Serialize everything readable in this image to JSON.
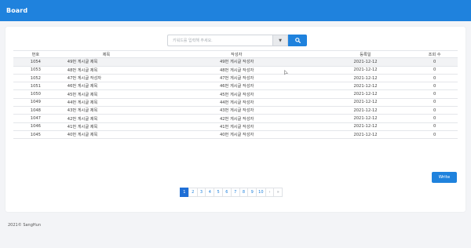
{
  "app": {
    "brand": "Board"
  },
  "search": {
    "placeholder": "키워드를 입력해 주세요.",
    "select_icon": "caret-down-icon",
    "button_icon": "search-icon"
  },
  "table": {
    "headers": {
      "no": "번호",
      "title": "제목",
      "writer": "작성자",
      "date": "등록일",
      "views": "조회 수"
    },
    "rows": [
      {
        "no": "1054",
        "title": "49번 게시글 제목",
        "writer": "49번 게시글 작성자",
        "date": "2021-12-12",
        "views": "0"
      },
      {
        "no": "1053",
        "title": "48번 게시글 제목",
        "writer": "48번 게시글 작성자",
        "date": "2021-12-12",
        "views": "0"
      },
      {
        "no": "1052",
        "title": "47번 게시글 작성자",
        "writer": "47번 게시글 작성자",
        "date": "2021-12-12",
        "views": "0"
      },
      {
        "no": "1051",
        "title": "46번 게시글 제목",
        "writer": "46번 게시글 작성자",
        "date": "2021-12-12",
        "views": "0"
      },
      {
        "no": "1050",
        "title": "45번 게시글 제목",
        "writer": "45번 게시글 작성자",
        "date": "2021-12-12",
        "views": "0"
      },
      {
        "no": "1049",
        "title": "44번 게시글 제목",
        "writer": "44번 게시글 작성자",
        "date": "2021-12-12",
        "views": "0"
      },
      {
        "no": "1048",
        "title": "43번 게시글 제목",
        "writer": "43번 게시글 작성자",
        "date": "2021-12-12",
        "views": "0"
      },
      {
        "no": "1047",
        "title": "42번 게시글 제목",
        "writer": "42번 게시글 작성자",
        "date": "2021-12-12",
        "views": "0"
      },
      {
        "no": "1046",
        "title": "41번 게시글 제목",
        "writer": "41번 게시글 작성자",
        "date": "2021-12-12",
        "views": "0"
      },
      {
        "no": "1045",
        "title": "40번 게시글 제목",
        "writer": "40번 게시글 작성자",
        "date": "2021-12-12",
        "views": "0"
      }
    ]
  },
  "write_label": "Write",
  "pagination": {
    "pages": [
      "1",
      "2",
      "3",
      "4",
      "5",
      "6",
      "7",
      "8",
      "9",
      "10"
    ],
    "next": "›",
    "last": "»",
    "active": "1"
  },
  "footer": "2021© SangHun",
  "colors": {
    "primary": "#1f82dd",
    "active_page": "#1f6fd6",
    "background": "#f3f4f7"
  }
}
